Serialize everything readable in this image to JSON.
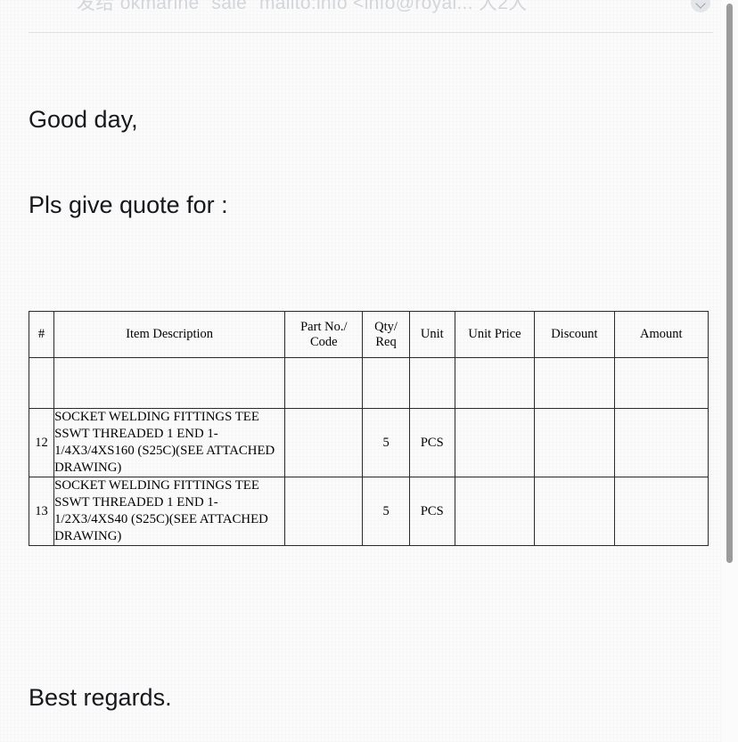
{
  "quoted_header": {
    "text": "发给 okmarine \"sale\" mailto:info <info@royal... 大2大",
    "avatar_icon": "chevron-down-icon"
  },
  "message": {
    "greeting": "Good day,",
    "request": "Pls give quote for :",
    "signoff": "Best regards."
  },
  "quote_table": {
    "columns": [
      {
        "key": "num",
        "label": "#"
      },
      {
        "key": "desc",
        "label": "Item Description"
      },
      {
        "key": "part",
        "label": "Part No./\nCode"
      },
      {
        "key": "qty",
        "label": "Qty/\nReq"
      },
      {
        "key": "unit",
        "label": "Unit"
      },
      {
        "key": "price",
        "label": "Unit Price"
      },
      {
        "key": "disc",
        "label": "Discount"
      },
      {
        "key": "amt",
        "label": "Amount"
      }
    ],
    "headers": {
      "num": "#",
      "desc": "Item Description",
      "part_line1": "Part No./",
      "part_line2": "Code",
      "qty_line1": "Qty/",
      "qty_line2": "Req",
      "unit": "Unit",
      "price": "Unit Price",
      "discount": "Discount",
      "amount": "Amount"
    },
    "rows": [
      {
        "num": "",
        "description": "",
        "part_no": "",
        "qty": "",
        "unit": "",
        "unit_price": "",
        "discount": "",
        "amount": ""
      },
      {
        "num": "12",
        "description": "SOCKET WELDING FITTINGS TEE SSWT THREADED 1 END 1-1/4X3/4XS160 (S25C)(SEE ATTACHED DRAWING)",
        "part_no": "",
        "qty": "5",
        "unit": "PCS",
        "unit_price": "",
        "discount": "",
        "amount": ""
      },
      {
        "num": "13",
        "description": "SOCKET WELDING FITTINGS TEE SSWT THREADED 1 END 1-1/2X3/4XS40 (S25C)(SEE ATTACHED DRAWING)",
        "part_no": "",
        "qty": "5",
        "unit": "PCS",
        "unit_price": "",
        "discount": "",
        "amount": ""
      }
    ]
  },
  "colors": {
    "page_background": "#fbfbfb",
    "text": "#16181c",
    "table_border": "#2a2a2a",
    "divider": "#dcdfe3",
    "scrollbar_thumb": "#9b9b9b",
    "quoted_header_text": "#d2d5da"
  }
}
